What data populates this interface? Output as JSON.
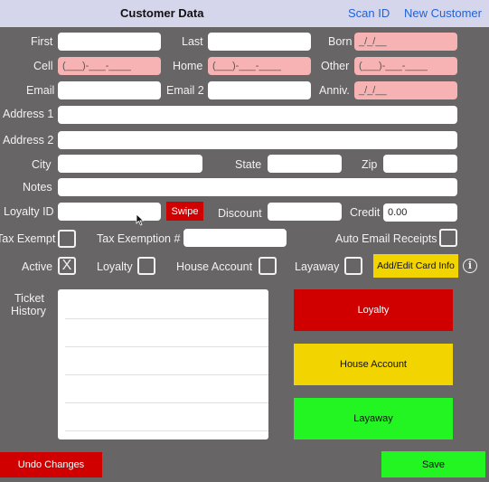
{
  "header": {
    "title": "Customer Data",
    "scan_id": "Scan ID",
    "new_customer": "New Customer"
  },
  "labels": {
    "first": "First",
    "last": "Last",
    "born": "Born",
    "cell": "Cell",
    "home": "Home",
    "other": "Other",
    "email": "Email",
    "email2": "Email 2",
    "anniv": "Anniv.",
    "address1": "Address 1",
    "address2": "Address 2",
    "city": "City",
    "state": "State",
    "zip": "Zip",
    "notes": "Notes",
    "loyalty_id": "Loyalty ID",
    "discount": "Discount",
    "credit": "Credit",
    "tax_exempt": "Tax Exempt",
    "tax_exemption_no": "Tax Exemption #",
    "auto_email": "Auto Email Receipts",
    "active": "Active",
    "loyalty": "Loyalty",
    "house_account": "House Account",
    "layaway": "Layaway",
    "ticket_history_1": "Ticket",
    "ticket_history_2": "History"
  },
  "fields": {
    "first": "",
    "last": "",
    "born": "_/_/__",
    "cell": "(___)-___-____",
    "home": "(___)-___-____",
    "other": "(___)-___-____",
    "email": "",
    "email2": "",
    "anniv": "_/_/__",
    "address1": "",
    "address2": "",
    "city": "",
    "state": "",
    "zip": "",
    "notes": "",
    "loyalty_id": "",
    "discount": "",
    "credit": "0.00",
    "tax_exemption_no": ""
  },
  "checkboxes": {
    "tax_exempt": "",
    "auto_email": "",
    "active": "X",
    "loyalty": "",
    "house_account": "",
    "layaway": ""
  },
  "buttons": {
    "swipe": "Swipe",
    "add_edit_card": "Add/Edit Card Info",
    "loyalty": "Loyalty",
    "house_account": "House Account",
    "layaway": "Layaway",
    "undo": "Undo Changes",
    "save": "Save"
  },
  "icons": {
    "info": "i"
  },
  "colors": {
    "pink_field": "#f7b3b3",
    "red": "#d10000",
    "yellow": "#f2d400",
    "green": "#22f522",
    "link": "#1f63d8"
  }
}
